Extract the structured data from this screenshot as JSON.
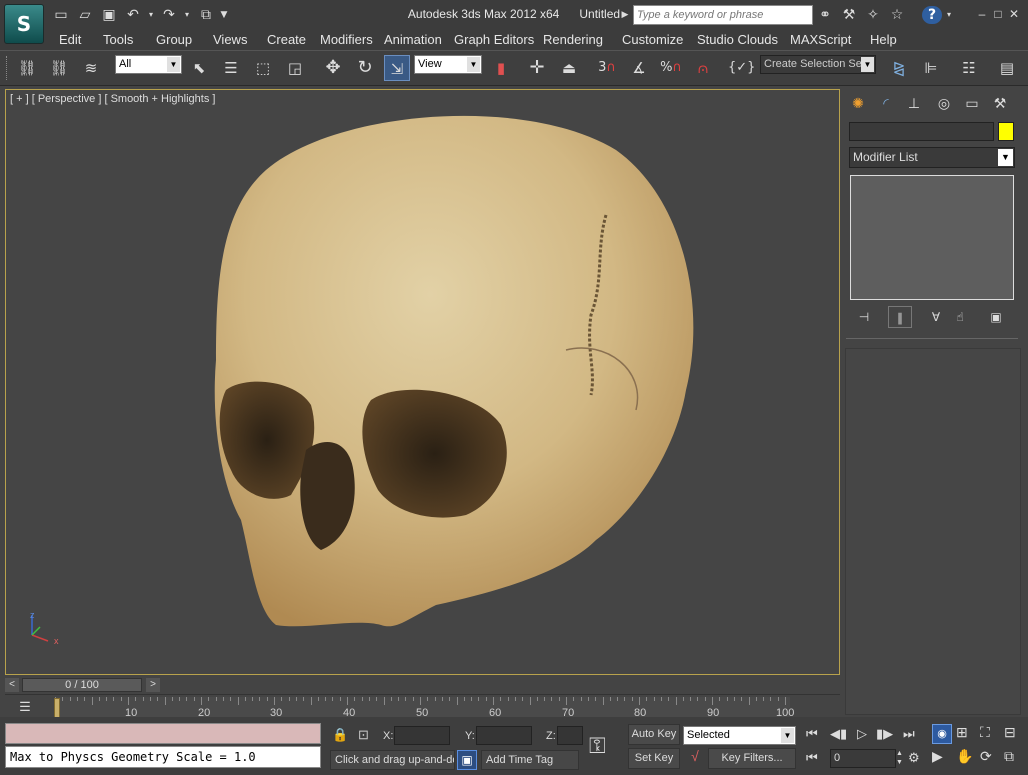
{
  "app": {
    "title": "Autodesk 3ds Max  2012 x64",
    "document": "Untitled",
    "logo_text": "S"
  },
  "search": {
    "placeholder": "Type a keyword or phrase"
  },
  "menu": [
    "Edit",
    "Tools",
    "Group",
    "Views",
    "Create",
    "Modifiers",
    "Animation",
    "Graph Editors",
    "Rendering",
    "Customize",
    "Studio Clouds",
    "MAXScript",
    "Help"
  ],
  "toolbar": {
    "selection_filter": "All",
    "reference_coord": "View",
    "named_selection": "Create Selection Se",
    "snap_count": "3",
    "angle_snap_label": "%"
  },
  "viewport": {
    "label": "[ + ] [ Perspective ] [ Smooth + Highlights ]",
    "axis_z": "z",
    "axis_x": "x"
  },
  "command_panel": {
    "modifier_list": "Modifier List",
    "name_field": "",
    "object_color": "#ffff00"
  },
  "timeline": {
    "frame_display": "0 / 100",
    "ticks": [
      "0",
      "10",
      "20",
      "30",
      "40",
      "50",
      "60",
      "70",
      "80",
      "90",
      "100"
    ]
  },
  "status": {
    "maxscript_output": "Max to Physcs Geometry Scale = 1.0",
    "prompt": "Click and drag up-and-do",
    "add_time_tag": "Add Time Tag",
    "x_label": "X:",
    "y_label": "Y:",
    "z_label": "Z:",
    "x_value": "",
    "y_value": "",
    "z_value": ""
  },
  "anim": {
    "auto_key": "Auto Key",
    "set_key": "Set Key",
    "key_mode": "Selected",
    "key_filters": "Key Filters...",
    "current_frame": "0"
  },
  "colors": {
    "viewport_border": "#b8a24c",
    "logo_teal": "#2a7a7a",
    "accent_blue": "#3a78c8"
  }
}
